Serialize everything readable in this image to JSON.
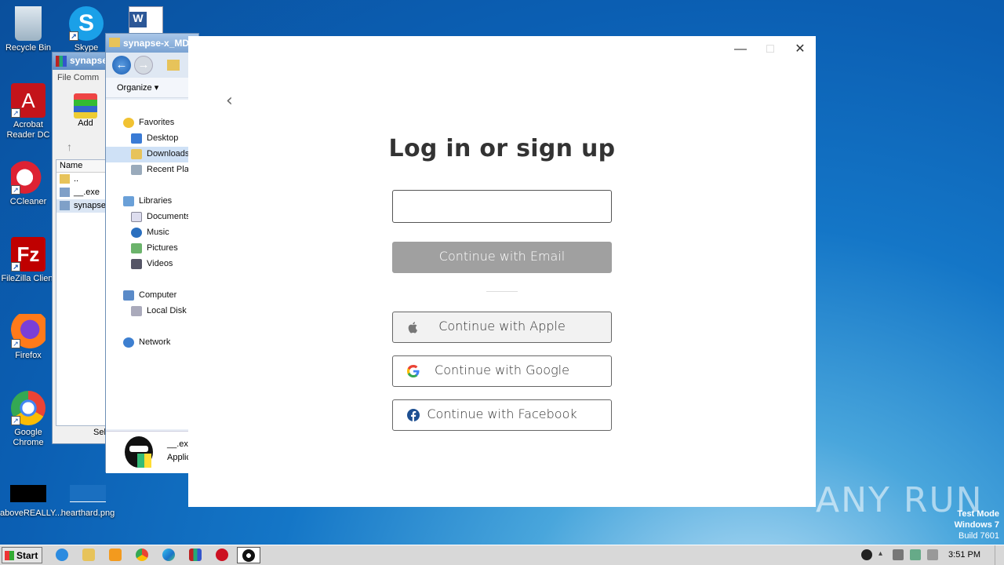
{
  "desktop": {
    "icons": [
      {
        "label": "Recycle Bin"
      },
      {
        "label": "Skype"
      },
      {
        "label": "Acrobat Reader DC"
      },
      {
        "label": "CCleaner"
      },
      {
        "label": "FileZilla Client"
      },
      {
        "label": "Firefox"
      },
      {
        "label": "Google Chrome"
      },
      {
        "label": "aboveREALLY..."
      },
      {
        "label": "hearthard.png"
      }
    ]
  },
  "winrar": {
    "title": "synapse",
    "menu": "File  Comm",
    "add_label": "Add",
    "col_name": "Name",
    "rows": [
      "..",
      "__.exe",
      "synapse"
    ],
    "status": "Sele"
  },
  "explorer": {
    "title": "synapse-x_MD",
    "organize": "Organize",
    "nav": {
      "favorites": "Favorites",
      "desktop": "Desktop",
      "downloads": "Downloads",
      "recent": "Recent Plac",
      "libraries": "Libraries",
      "documents": "Documents",
      "music": "Music",
      "pictures": "Pictures",
      "videos": "Videos",
      "computer": "Computer",
      "local_disk": "Local Disk (",
      "network": "Network"
    },
    "detail_name": "__.ex",
    "detail_type": "Applic"
  },
  "dialog": {
    "heading": "Log in or sign up",
    "email_value": "",
    "continue_email": "Continue with Email",
    "continue_apple": "Continue with Apple",
    "continue_google": "Continue with Google",
    "continue_facebook": "Continue with Facebook",
    "minimize": "—",
    "maximize": "□",
    "close": "✕",
    "back": "‹"
  },
  "watermark": "ANY RUN",
  "testmode": {
    "line1": "Test Mode",
    "line2": "Windows 7",
    "line3": "Build 7601"
  },
  "taskbar": {
    "start": "Start",
    "clock": "3:51 PM"
  },
  "colors": {
    "email_button": "#a0a0a0",
    "apple_button_bg": "#f2f2f2",
    "facebook_blue": "#1877f2"
  }
}
